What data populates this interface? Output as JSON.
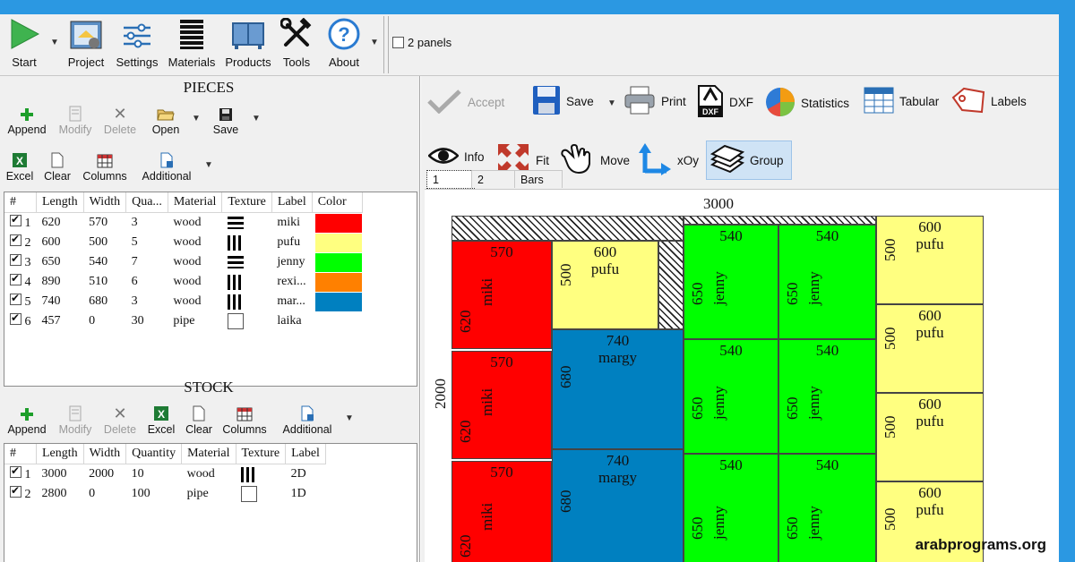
{
  "main_toolbar": {
    "start": "Start",
    "project": "Project",
    "settings": "Settings",
    "materials": "Materials",
    "products": "Products",
    "tools": "Tools",
    "about": "About",
    "two_panels": "2 panels"
  },
  "pieces": {
    "title": "PIECES",
    "buttons": {
      "append": "Append",
      "modify": "Modify",
      "delete": "Delete",
      "open": "Open",
      "save": "Save",
      "excel": "Excel",
      "clear": "Clear",
      "columns": "Columns",
      "additional": "Additional"
    },
    "columns": [
      "#",
      "Length",
      "Width",
      "Qua...",
      "Material",
      "Texture",
      "Label",
      "Color"
    ],
    "rows": [
      {
        "num": "1",
        "length": "620",
        "width": "570",
        "qty": "3",
        "material": "wood",
        "texture": "horizontal",
        "label": "miki",
        "color": "#ff0000"
      },
      {
        "num": "2",
        "length": "600",
        "width": "500",
        "qty": "5",
        "material": "wood",
        "texture": "vertical",
        "label": "pufu",
        "color": "#ffff80"
      },
      {
        "num": "3",
        "length": "650",
        "width": "540",
        "qty": "7",
        "material": "wood",
        "texture": "horizontal",
        "label": "jenny",
        "color": "#00ff00"
      },
      {
        "num": "4",
        "length": "890",
        "width": "510",
        "qty": "6",
        "material": "wood",
        "texture": "vertical",
        "label": "rexi...",
        "color": "#ff8000"
      },
      {
        "num": "5",
        "length": "740",
        "width": "680",
        "qty": "3",
        "material": "wood",
        "texture": "vertical",
        "label": "mar...",
        "color": "#0080c0"
      },
      {
        "num": "6",
        "length": "457",
        "width": "0",
        "qty": "30",
        "material": "pipe",
        "texture": "none",
        "label": "laika",
        "color": ""
      }
    ]
  },
  "stock": {
    "title": "STOCK",
    "buttons": {
      "append": "Append",
      "modify": "Modify",
      "delete": "Delete",
      "excel": "Excel",
      "clear": "Clear",
      "columns": "Columns",
      "additional": "Additional"
    },
    "columns": [
      "#",
      "Length",
      "Width",
      "Quantity",
      "Material",
      "Texture",
      "Label"
    ],
    "rows": [
      {
        "num": "1",
        "length": "3000",
        "width": "2000",
        "qty": "10",
        "material": "wood",
        "texture": "vertical",
        "label": "2D"
      },
      {
        "num": "2",
        "length": "2800",
        "width": "0",
        "qty": "100",
        "material": "pipe",
        "texture": "none",
        "label": "1D"
      }
    ]
  },
  "layout_toolbar": {
    "accept": "Accept",
    "save": "Save",
    "print": "Print",
    "dxf": "DXF",
    "statistics": "Statistics",
    "tabular": "Tabular",
    "labels": "Labels",
    "info": "Info",
    "fit": "Fit",
    "move": "Move",
    "xoy": "xOy",
    "group": "Group",
    "tabs": [
      "1",
      "2",
      "Bars"
    ]
  },
  "sheet": {
    "width_label": "3000",
    "height_label": "2000",
    "pieces": [
      {
        "w": "570",
        "l": "620",
        "label": "miki",
        "color": "#ff0000"
      },
      {
        "w": "570",
        "l": "620",
        "label": "miki",
        "color": "#ff0000"
      },
      {
        "w": "570",
        "l": "620",
        "label": "miki",
        "color": "#ff0000"
      },
      {
        "w": "600",
        "l": "500",
        "label": "pufu",
        "color": "#ffff80"
      },
      {
        "w": "740",
        "l": "680",
        "label": "margy",
        "color": "#0080c0"
      },
      {
        "w": "740",
        "l": "680",
        "label": "margy",
        "color": "#0080c0"
      },
      {
        "w": "540",
        "l": "650",
        "label": "jenny",
        "color": "#00ff00"
      },
      {
        "w": "540",
        "l": "650",
        "label": "jenny",
        "color": "#00ff00"
      },
      {
        "w": "540",
        "l": "650",
        "label": "jenny",
        "color": "#00ff00"
      },
      {
        "w": "540",
        "l": "650",
        "label": "jenny",
        "color": "#00ff00"
      },
      {
        "w": "540",
        "l": "650",
        "label": "jenny",
        "color": "#00ff00"
      },
      {
        "w": "540",
        "l": "650",
        "label": "jenny",
        "color": "#00ff00"
      },
      {
        "w": "600",
        "l": "500",
        "label": "pufu",
        "color": "#ffff80"
      },
      {
        "w": "600",
        "l": "500",
        "label": "pufu",
        "color": "#ffff80"
      },
      {
        "w": "600",
        "l": "500",
        "label": "pufu",
        "color": "#ffff80"
      },
      {
        "w": "600",
        "l": "500",
        "label": "pufu",
        "color": "#ffff80"
      }
    ]
  },
  "watermark": "arabprograms.org"
}
